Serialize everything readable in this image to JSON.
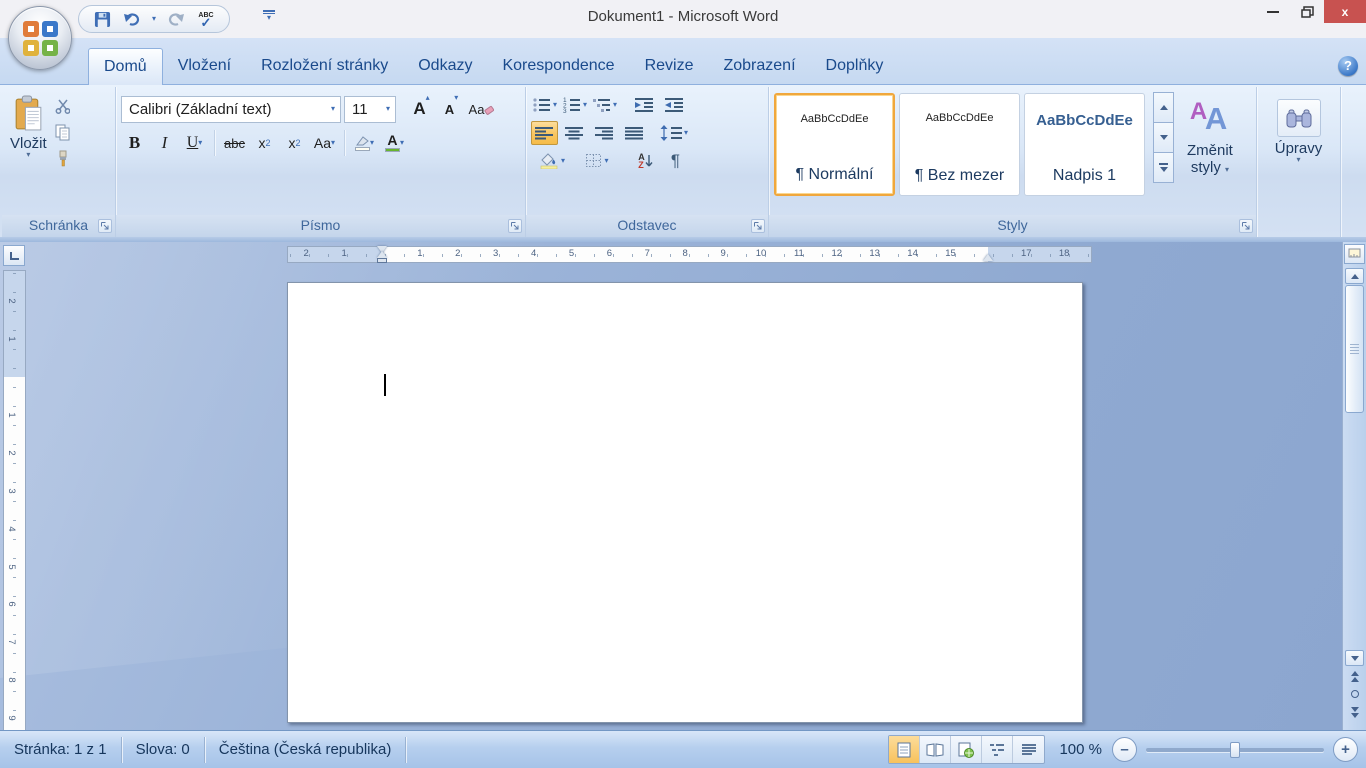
{
  "window": {
    "title": "Dokument1 - Microsoft Word"
  },
  "colors": {
    "accent_orange": "#f6c35d",
    "close_red": "#c85250",
    "font_color_bar": "#67b52f",
    "highlight_bar": "#fffef2"
  },
  "tabs": [
    {
      "id": "domu",
      "label": "Domů",
      "active": true
    },
    {
      "id": "vlozeni",
      "label": "Vložení",
      "active": false
    },
    {
      "id": "rozlozeni-stranky",
      "label": "Rozložení stránky",
      "active": false
    },
    {
      "id": "odkazy",
      "label": "Odkazy",
      "active": false
    },
    {
      "id": "korespondence",
      "label": "Korespondence",
      "active": false
    },
    {
      "id": "revize",
      "label": "Revize",
      "active": false
    },
    {
      "id": "zobrazeni",
      "label": "Zobrazení",
      "active": false
    },
    {
      "id": "doplnky",
      "label": "Doplňky",
      "active": false
    }
  ],
  "help": {
    "label": "?"
  },
  "ribbon": {
    "clipboard": {
      "paste_label": "Vložit",
      "group_label": "Schránka"
    },
    "font": {
      "font_name": "Calibri (Základní text)",
      "font_size": "11",
      "bold": "B",
      "italic": "I",
      "underline": "U",
      "strikethrough": "abc",
      "subscript_base": "x",
      "subscript": "2",
      "superscript_base": "x",
      "superscript": "2",
      "change_case": "Aa",
      "font_color_letter": "A",
      "group_label": "Písmo"
    },
    "paragraph": {
      "sort_a": "A",
      "sort_z": "Z",
      "pilcrow": "¶",
      "group_label": "Odstavec"
    },
    "styles": {
      "items": [
        {
          "id": "normalni",
          "preview": "AaBbCcDdEe",
          "name": "¶ Normální",
          "selected": true,
          "heading": false
        },
        {
          "id": "bez-mezer",
          "preview": "AaBbCcDdEe",
          "name": "¶ Bez mezer",
          "selected": false,
          "heading": false
        },
        {
          "id": "nadpis-1",
          "preview": "AaBbCcDdEe",
          "name": "Nadpis 1",
          "selected": false,
          "heading": true
        }
      ],
      "change_styles_line1": "Změnit",
      "change_styles_line2": "styly",
      "group_label": "Styly"
    },
    "editing": {
      "label": "Úpravy"
    }
  },
  "ruler": {
    "horizontal": [
      {
        "cm": -2,
        "label": "2"
      },
      {
        "cm": -1,
        "label": "1"
      },
      {
        "cm": 1,
        "label": "1"
      },
      {
        "cm": 2,
        "label": "2"
      },
      {
        "cm": 3,
        "label": "3"
      },
      {
        "cm": 4,
        "label": "4"
      },
      {
        "cm": 5,
        "label": "5"
      },
      {
        "cm": 6,
        "label": "6"
      },
      {
        "cm": 7,
        "label": "7"
      },
      {
        "cm": 8,
        "label": "8"
      },
      {
        "cm": 9,
        "label": "9"
      },
      {
        "cm": 10,
        "label": "10"
      },
      {
        "cm": 11,
        "label": "11"
      },
      {
        "cm": 12,
        "label": "12"
      },
      {
        "cm": 13,
        "label": "13"
      },
      {
        "cm": 14,
        "label": "14"
      },
      {
        "cm": 15,
        "label": "15"
      },
      {
        "cm": 17,
        "label": "17"
      },
      {
        "cm": 18,
        "label": "18"
      }
    ],
    "vertical": [
      {
        "cm": -2,
        "label": "2"
      },
      {
        "cm": -1,
        "label": "1"
      },
      {
        "cm": 1,
        "label": "1"
      },
      {
        "cm": 2,
        "label": "2"
      },
      {
        "cm": 3,
        "label": "3"
      },
      {
        "cm": 4,
        "label": "4"
      },
      {
        "cm": 5,
        "label": "5"
      },
      {
        "cm": 6,
        "label": "6"
      },
      {
        "cm": 7,
        "label": "7"
      },
      {
        "cm": 8,
        "label": "8"
      },
      {
        "cm": 9,
        "label": "9"
      }
    ]
  },
  "status_bar": {
    "page": "Stránka: 1 z 1",
    "words": "Slova: 0",
    "language": "Čeština (Česká republika)",
    "zoom_level": "100 %"
  }
}
